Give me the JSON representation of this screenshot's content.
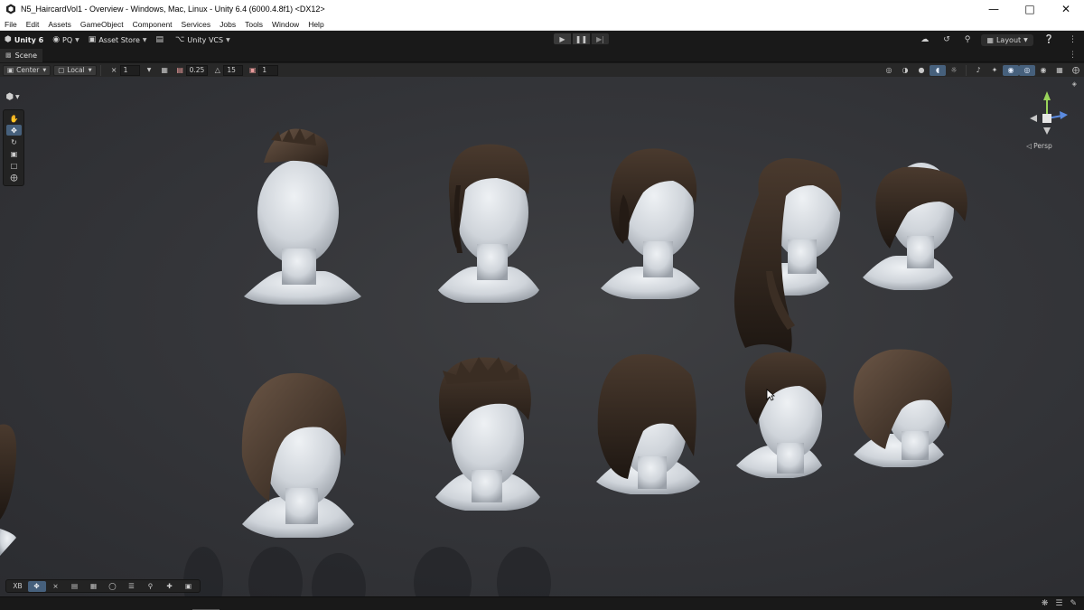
{
  "window": {
    "title": "N5_HaircardVol1 - Overview - Windows, Mac, Linux - Unity 6.4 (6000.4.8f1) <DX12>",
    "minimize_icon": "minimize-icon",
    "maximize_icon": "maximize-icon",
    "close_icon": "close-icon"
  },
  "menu": [
    "File",
    "Edit",
    "Assets",
    "GameObject",
    "Component",
    "Services",
    "Jobs",
    "Tools",
    "Window",
    "Help"
  ],
  "toolbar": {
    "unity_label": "Unity 6",
    "account_label": "PQ",
    "asset_store_label": "Asset Store",
    "vcs_label": "Unity VCS",
    "layout_label": "Layout"
  },
  "tabs": {
    "scene_label": "Scene"
  },
  "scene_toolbar": {
    "pivot_label": "Center",
    "space_label": "Local",
    "grid_count": "1",
    "snap_value": "0.25",
    "rotate_snap": "15",
    "scale_snap": "1"
  },
  "gizmo": {
    "projection_label": "◁ Persp"
  },
  "overlay": {
    "xr_label": "XB"
  },
  "colors": {
    "accent": "#46607c",
    "viewport_bg": "#36373b",
    "head_skin": "#d9dde2",
    "hair_dark": "#2a221c"
  }
}
